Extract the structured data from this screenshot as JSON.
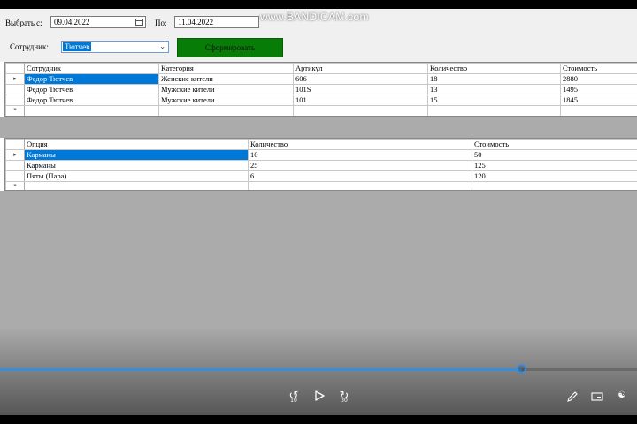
{
  "overlay": {
    "watermark": "www.BANDICAM.com"
  },
  "filter": {
    "from_label": "Выбрать с:",
    "from_value": "09.04.2022",
    "to_label": "По:",
    "to_value": "11.04.2022",
    "employee_label": "Сотрудник:",
    "employee_value": "Тютчев",
    "generate_button": "Сформировать"
  },
  "orders_grid": {
    "columns": [
      "Сотрудник",
      "Категория",
      "Артикул",
      "Количество",
      "Стоимость"
    ],
    "rows": [
      [
        "Федор Тютчев",
        "Женские кители",
        "606",
        "18",
        "2880"
      ],
      [
        "Федор Тютчев",
        "Мужские кители",
        "101S",
        "13",
        "1495"
      ],
      [
        "Федор Тютчев",
        "Мужские кители",
        "101",
        "15",
        "1845"
      ]
    ]
  },
  "options_grid": {
    "columns": [
      "Опция",
      "Количество",
      "Стоимость"
    ],
    "rows": [
      [
        "Карманы",
        "10",
        "50"
      ],
      [
        "Карманы",
        "25",
        "125"
      ],
      [
        "Пяты (Пара)",
        "6",
        "120"
      ]
    ]
  },
  "player": {
    "progress": 0.82,
    "rewind_label": "10",
    "forward_label": "30",
    "accent": "#3a8bd8"
  }
}
